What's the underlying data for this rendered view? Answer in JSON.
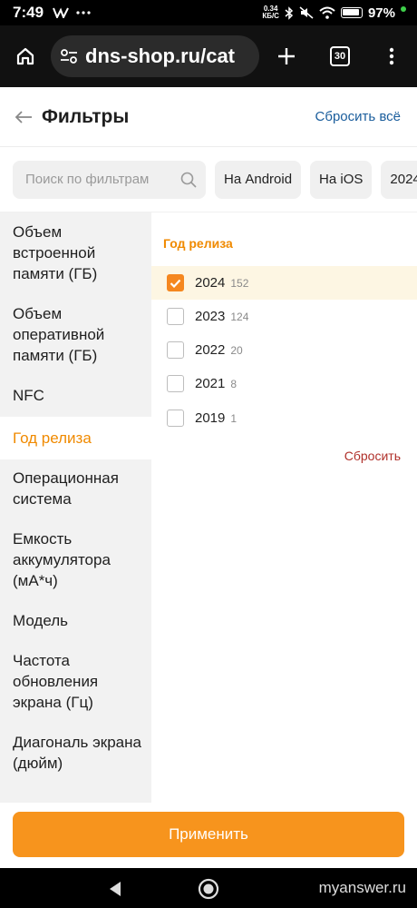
{
  "status_bar": {
    "time": "7:49",
    "netspeed_value": "0.34",
    "netspeed_unit": "КБ/С",
    "battery_percent": "97%",
    "icons": [
      "vk-icon",
      "more-dots-icon",
      "bluetooth-icon",
      "mute-icon",
      "wifi-icon",
      "battery-icon"
    ]
  },
  "browser": {
    "url": "dns-shop.ru/cat",
    "tab_count": "30",
    "icons": [
      "home-icon",
      "site-settings-icon",
      "plus-icon",
      "tabs-icon",
      "menu-dots-icon"
    ]
  },
  "header": {
    "title": "Фильтры",
    "reset_all": "Сбросить всё"
  },
  "search": {
    "placeholder": "Поиск по фильтрам"
  },
  "chips": [
    "На Android",
    "На iOS",
    "2024"
  ],
  "sidebar": {
    "items": [
      {
        "label": "Объем встроенной памяти (ГБ)",
        "active": false
      },
      {
        "label": "Объем оперативной памяти (ГБ)",
        "active": false
      },
      {
        "label": "NFC",
        "active": false
      },
      {
        "label": "Год релиза",
        "active": true
      },
      {
        "label": "Операционная система",
        "active": false
      },
      {
        "label": "Емкость аккумулятора (мА*ч)",
        "active": false
      },
      {
        "label": "Модель",
        "active": false
      },
      {
        "label": "Частота обновления экрана (Гц)",
        "active": false
      },
      {
        "label": "Диагональ экрана (дюйм)",
        "active": false
      }
    ]
  },
  "filter_group": {
    "title": "Год релиза",
    "options": [
      {
        "label": "2024",
        "count": "152",
        "checked": true
      },
      {
        "label": "2023",
        "count": "124",
        "checked": false
      },
      {
        "label": "2022",
        "count": "20",
        "checked": false
      },
      {
        "label": "2021",
        "count": "8",
        "checked": false
      },
      {
        "label": "2019",
        "count": "1",
        "checked": false
      }
    ],
    "reset": "Сбросить"
  },
  "apply_button": "Применить",
  "watermark": "myanswer.ru",
  "colors": {
    "accent": "#f7941d",
    "active_text": "#f08a00",
    "link": "#1a5d9c",
    "reset_red": "#b0302a"
  }
}
